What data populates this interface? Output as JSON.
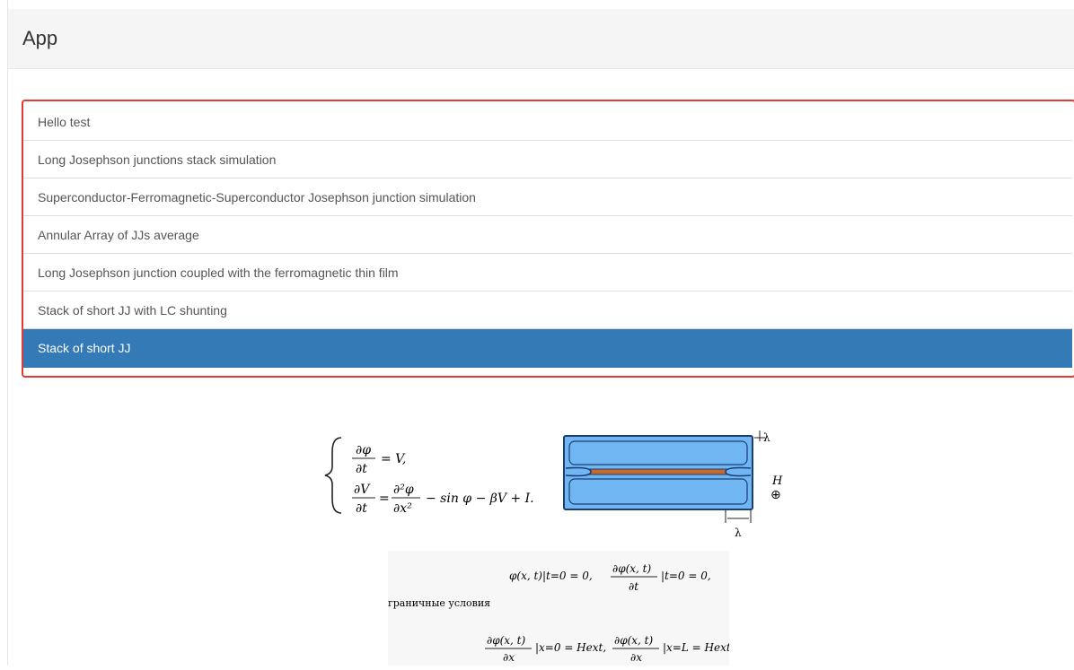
{
  "app": {
    "title": "App"
  },
  "list": {
    "items": [
      {
        "label": "Hello test"
      },
      {
        "label": "Long Josephson junctions stack simulation"
      },
      {
        "label": "Superconductor-Ferromagnetic-Superconductor Josephson junction simulation"
      },
      {
        "label": "Annular Array of JJs average"
      },
      {
        "label": "Long Josephson junction coupled with the ferromagnetic thin film"
      },
      {
        "label": "Stack of short JJ with LC shunting"
      },
      {
        "label": "Stack of short JJ",
        "selected": true
      }
    ]
  },
  "figure": {
    "eq1_num": "∂φ",
    "eq1_den": "∂t",
    "eq1_rhs": "= V,",
    "eq2_num": "∂V",
    "eq2_den": "∂t",
    "eq2_mid_num": "∂²φ",
    "eq2_mid_den": "∂x²",
    "eq2_rhs": "− sin φ − βV + I.",
    "lambda_top": "λ",
    "lambda_bottom": "λ",
    "h_label": "H",
    "h_symbol": "⊕"
  },
  "conditions": {
    "initial": "φ(x, t)|t=0 = 0,",
    "initial2_num": "∂φ(x, t)",
    "initial2_den": "∂t",
    "initial2_rhs": "|t=0 = 0,",
    "label": "граничные условия",
    "bc1_num": "∂φ(x, t)",
    "bc1_den": "∂x",
    "bc1_rhs": "|x=0 = Hext,",
    "bc2_num": "∂φ(x, t)",
    "bc2_den": "∂x",
    "bc2_rhs": "|x=L = Hext"
  },
  "colors": {
    "selected": "#337ab7",
    "highlight_border": "#e53935",
    "junction_blue": "#6fb6f2",
    "junction_orange": "#c46a2a"
  }
}
